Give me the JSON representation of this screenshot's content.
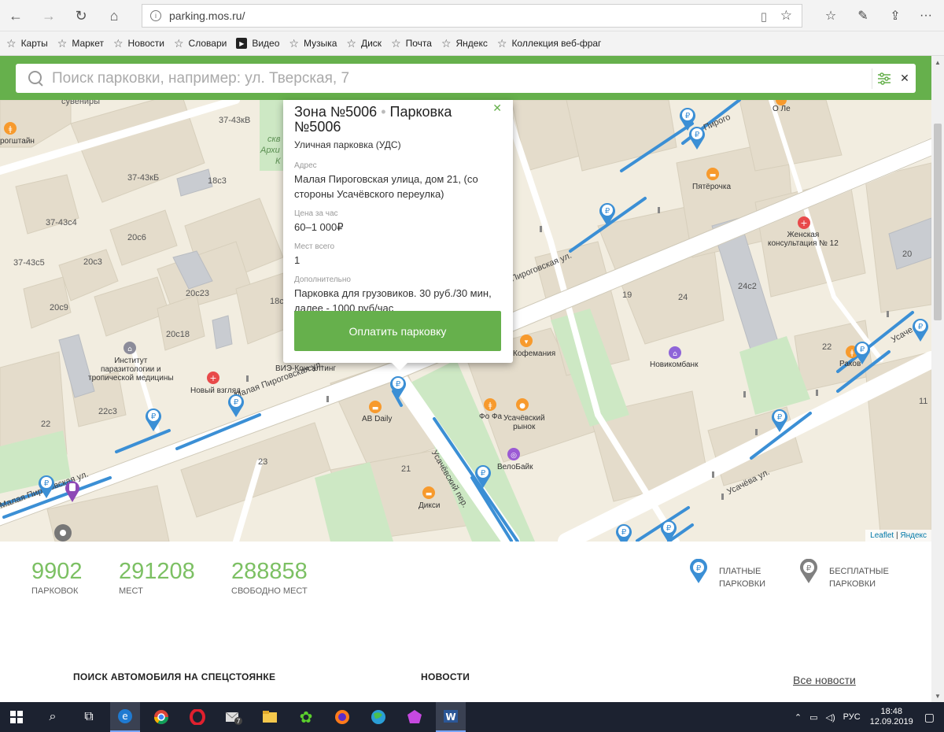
{
  "browser": {
    "url": "parking.mos.ru/",
    "bookmarks": [
      "Карты",
      "Маркет",
      "Новости",
      "Словари",
      "Видео",
      "Музыка",
      "Диск",
      "Почта",
      "Яндекс",
      "Коллекция веб-фраг"
    ]
  },
  "search": {
    "placeholder": "Поиск парковки, например: ул. Тверская, 7"
  },
  "map": {
    "labels": {
      "l1": "сувениры",
      "l2": "37-43кВ",
      "l3": "37-43кБ",
      "l4": "18с3",
      "l5": "37-43с4",
      "l6": "20с6",
      "l7": "20с3",
      "l8": "37-43с5",
      "l9": "20с9",
      "l10": "20с23",
      "l11": "18с",
      "l12": "20с18",
      "l13": "22с3",
      "l14": "22",
      "l15": "23",
      "l16": "21",
      "l17": "19",
      "l18": "24",
      "l19": "24с2",
      "l20": "20",
      "l21": "22",
      "l22": "11",
      "park1": "скв",
      "park2": "Архи",
      "park3": "К"
    },
    "streets": {
      "s1": "Малая Пироговская ул.",
      "s2": "Малая Пироговская ул.",
      "s3": "Пироговская ул.",
      "s4": "Пирого",
      "s5": "Усачёвский пер.",
      "s6": "Усачёва ул.",
      "s7": "Усаче"
    },
    "pois": {
      "p1": "рогштайн",
      "p2": "Институт\nпаразитологии и\nтропической медицины",
      "p3": "Новый взгляд",
      "p4": "ВИЭ-Консалтинг",
      "p5": "АВ Daily",
      "p6": "Дикси",
      "p7": "Усачёвский\nрынок",
      "p8": "Фо Фа",
      "p9": "ВелоБайк",
      "p10": "Кофемания",
      "p11": "Новикомбанк",
      "p12": "Пятёрочка",
      "p13": "Женская\nконсультация № 12",
      "p14": "Раков",
      "p15": "О Ле"
    },
    "attribution": {
      "leaflet": "Leaflet",
      "sep": " | ",
      "yandex": "Яндекс"
    }
  },
  "popup": {
    "title_zone": "Зона №5006",
    "title_dot": " • ",
    "title_parking": "Парковка №5006",
    "subtitle": "Уличная парковка (УДС)",
    "address_label": "Адрес",
    "address": "Малая Пироговская улица, дом 21, (со стороны Усачёвского переулка)",
    "price_label": "Цена за час",
    "price": "60–1 000₽",
    "spots_label": "Мест всего",
    "spots": "1",
    "extra_label": "Дополнительно",
    "extra": "Парковка для грузовиков. 30 руб./30 мин, далее - 1000 руб/час",
    "pay_button": "Оплатить парковку"
  },
  "stats": {
    "parkings_value": "9902",
    "parkings_label": "парковок",
    "places_value": "291208",
    "places_label": "мест",
    "free_value": "288858",
    "free_label": "свободно мест",
    "paid_label_1": "платные",
    "paid_label_2": "парковки",
    "free_label_1": "бесплатные",
    "free_label_2": "парковки"
  },
  "sections": {
    "car_search": "ПОИСК АВТОМОБИЛЯ НА СПЕЦСТОЯНКЕ",
    "news": "НОВОСТИ",
    "all_news": "Все новости"
  },
  "taskbar": {
    "lang": "РУС",
    "time": "18:48",
    "date": "12.09.2019",
    "mail_badge": "7"
  },
  "colors": {
    "brand_green": "#66b04c",
    "stat_green": "#7cc063",
    "parking_blue": "#3b8fd5",
    "free_gray": "#808080"
  }
}
